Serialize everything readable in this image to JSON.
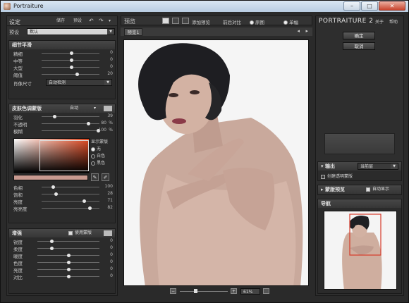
{
  "window": {
    "title": "Portraiture",
    "close_glyph": "✕",
    "min_glyph": "–",
    "max_glyph": "□"
  },
  "left": {
    "settings_label": "设定",
    "save_label": "储存",
    "reset_label": "预设",
    "preset_label": "预设",
    "preset_value": "默认",
    "detail": {
      "title": "细节平滑",
      "rows": [
        {
          "label": "精细",
          "value": "0"
        },
        {
          "label": "中等",
          "value": "0"
        },
        {
          "label": "大型",
          "value": "0"
        },
        {
          "label": "阈值",
          "value": "20"
        }
      ],
      "size_label": "肖像尺寸",
      "size_value": "自动检测"
    },
    "mask": {
      "title": "皮肤色调蒙版",
      "auto_label": "自动",
      "rows": [
        {
          "label": "羽化",
          "value": "39"
        },
        {
          "label": "不透明",
          "value": "80",
          "unit": "%"
        },
        {
          "label": "模糊",
          "value": "100",
          "unit": "%"
        }
      ],
      "show_mask_label": "显示蒙版",
      "radio": [
        "无",
        "白色",
        "黑色"
      ],
      "rows2": [
        {
          "label": "色相",
          "value": "100"
        },
        {
          "label": "饱和",
          "value": "28"
        },
        {
          "label": "亮度",
          "value": "71"
        },
        {
          "label": "亮亮度",
          "value": "82"
        }
      ]
    },
    "enhance": {
      "title": "增强",
      "use_mask_label": "使用蒙版",
      "rows": [
        {
          "label": "锐度",
          "value": "0"
        },
        {
          "label": "柔度",
          "value": "0"
        },
        {
          "label": "暖度",
          "value": "0"
        },
        {
          "label": "色度",
          "value": "0"
        },
        {
          "label": "亮度",
          "value": "0"
        },
        {
          "label": "对比",
          "value": "0"
        }
      ]
    }
  },
  "center": {
    "preview_label": "预览",
    "add_preview": "添加预览",
    "before_after": "前后对比",
    "orig_label": "原图",
    "single_label": "单幅",
    "tab_label": "预览1",
    "zoom_value": "61%"
  },
  "right": {
    "brand": "PORTRAITURE 2",
    "about": "关于",
    "help": "帮助",
    "ok": "确定",
    "cancel": "取消",
    "output_title": "输出",
    "output_value": "当前层",
    "output_check": "创建透明蒙版",
    "mask_preview_title": "蒙版预览",
    "auto_show": "自动显示",
    "navigator_title": "导航"
  },
  "colors": {
    "accent": "#d63a2a",
    "swatch_bar": "#c89a90"
  }
}
